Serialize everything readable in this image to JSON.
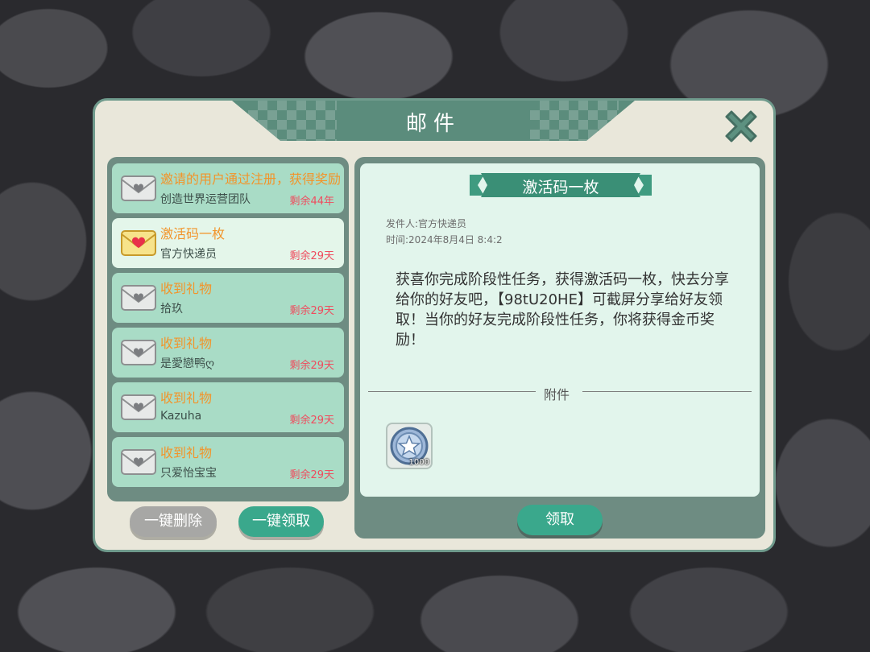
{
  "dialog": {
    "title": "邮件"
  },
  "mail_list": [
    {
      "subject": "邀请的用户通过注册，获得奖励",
      "sender": "创造世界运营团队",
      "remain": "剩余44年",
      "icon": "envelope-icon",
      "selected": false
    },
    {
      "subject": "激活码一枚",
      "sender": "官方快递员",
      "remain": "剩余29天",
      "icon": "heart-envelope-icon",
      "selected": true
    },
    {
      "subject": "收到礼物",
      "sender": "拾玖",
      "remain": "剩余29天",
      "icon": "envelope-icon",
      "selected": false
    },
    {
      "subject": "收到礼物",
      "sender": "是愛戀鸭ღ",
      "remain": "剩余29天",
      "icon": "envelope-icon",
      "selected": false
    },
    {
      "subject": "收到礼物",
      "sender": "Kazuha",
      "remain": "剩余29天",
      "icon": "envelope-icon",
      "selected": false
    },
    {
      "subject": "收到礼物",
      "sender": "只爱怡宝宝",
      "remain": "剩余29天",
      "icon": "envelope-icon",
      "selected": false
    }
  ],
  "buttons": {
    "delete_all": "一键删除",
    "claim_all": "一键领取",
    "claim": "领取"
  },
  "detail": {
    "title": "激活码一枚",
    "sender_line": "发件人:官方快递员",
    "time_line": "时间:2024年8月4日 8:4:2",
    "body": "获喜你完成阶段性任务，获得激活码一枚，快去分享给你的好友吧，【98tU20HE】可截屏分享给好友领取！当你的好友完成阶段性任务，你将获得金币奖励！",
    "attachment_label": "附件",
    "attachment": {
      "icon": "star-coin-icon",
      "quantity": "1000"
    }
  },
  "colors": {
    "accent": "#3aa88c",
    "panel": "#6e8c82",
    "subject": "#f2942a",
    "remain": "#ef4c5e"
  }
}
